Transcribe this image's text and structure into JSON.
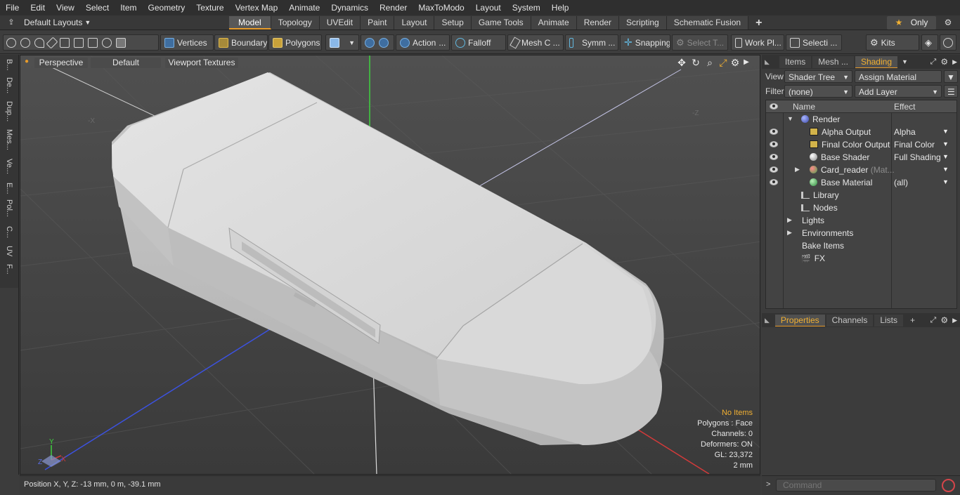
{
  "menubar": {
    "items": [
      "File",
      "Edit",
      "View",
      "Select",
      "Item",
      "Geometry",
      "Texture",
      "Vertex Map",
      "Animate",
      "Dynamics",
      "Render",
      "MaxToModo",
      "Layout",
      "System",
      "Help"
    ]
  },
  "tabrow": {
    "layouts_label": "Default Layouts",
    "tabs": [
      "Model",
      "Topology",
      "UVEdit",
      "Paint",
      "Layout",
      "Setup",
      "Game Tools",
      "Animate",
      "Render",
      "Scripting",
      "Schematic Fusion"
    ],
    "active_tab": "Model",
    "add_tab": "+",
    "only_label": "Only",
    "star": "★"
  },
  "toolbar": {
    "vertices": "Vertices",
    "boundary": "Boundary",
    "polygons": "Polygons",
    "action": "Action",
    "falloff": "Falloff",
    "mesh": "Mesh C ...",
    "symm": "Symm ...",
    "snapping": "Snapping",
    "select_t": "Select T...",
    "workpl": "Work Pl...",
    "selecti": "Selecti ...",
    "kits": "Kits"
  },
  "leftbar": {
    "tabs": [
      "B...",
      "De...",
      "Dup...",
      "Mes...",
      "Ve...",
      "E...",
      "Pol...",
      "C...",
      "UV",
      "F..."
    ]
  },
  "viewport": {
    "view_label": "Perspective",
    "style_label": "Default",
    "texture_label": "Viewport Textures",
    "axis_labels": {
      "x": "X",
      "y": "Y",
      "z": "Z",
      "neg_x": "-X",
      "neg_z": "-Z"
    },
    "info": {
      "items": "No Items",
      "polygons": "Polygons : Face",
      "channels": "Channels: 0",
      "deformers": "Deformers: ON",
      "gl": "GL: 23,372",
      "scale": "2 mm"
    }
  },
  "statusbar": {
    "position": "Position X, Y, Z:   -13 mm, 0 m, -39.1 mm"
  },
  "rpanel": {
    "top_tabs": [
      "Items",
      "Mesh ...",
      "Shading"
    ],
    "active_top": "Shading",
    "view_label": "View",
    "view_value": "Shader Tree",
    "assign_label": "Assign Material",
    "filter_label": "Filter",
    "filter_value": "(none)",
    "addlayer_label": "Add Layer",
    "columns": {
      "name": "Name",
      "effect": "Effect"
    },
    "tree": [
      {
        "name": "Render",
        "effect": "",
        "indent": 1
      },
      {
        "name": "Alpha Output",
        "effect": "Alpha",
        "indent": 2
      },
      {
        "name": "Final Color Output",
        "effect": "Final Color",
        "indent": 2
      },
      {
        "name": "Base Shader",
        "effect": "Full Shading",
        "indent": 2
      },
      {
        "name": "Card_reader",
        "hint": "(Mat...",
        "effect": "",
        "indent": 2
      },
      {
        "name": "Base Material",
        "effect": "(all)",
        "indent": 2
      },
      {
        "name": "Library",
        "effect": "",
        "indent": 1
      },
      {
        "name": "Nodes",
        "effect": "",
        "indent": 1
      },
      {
        "name": "Lights",
        "effect": "",
        "indent": 0
      },
      {
        "name": "Environments",
        "effect": "",
        "indent": 0
      },
      {
        "name": "Bake Items",
        "effect": "",
        "indent": 0
      },
      {
        "name": "FX",
        "effect": "",
        "indent": 1
      }
    ],
    "bottom_tabs": [
      "Properties",
      "Channels",
      "Lists",
      "+"
    ],
    "active_bottom": "Properties",
    "command_placeholder": "Command"
  },
  "colors": {
    "accent": "#e79b2a",
    "highlight": "#f1b033",
    "axis_x": "#d23a3a",
    "axis_y": "#3fd13f",
    "axis_z": "#3c52e0"
  }
}
